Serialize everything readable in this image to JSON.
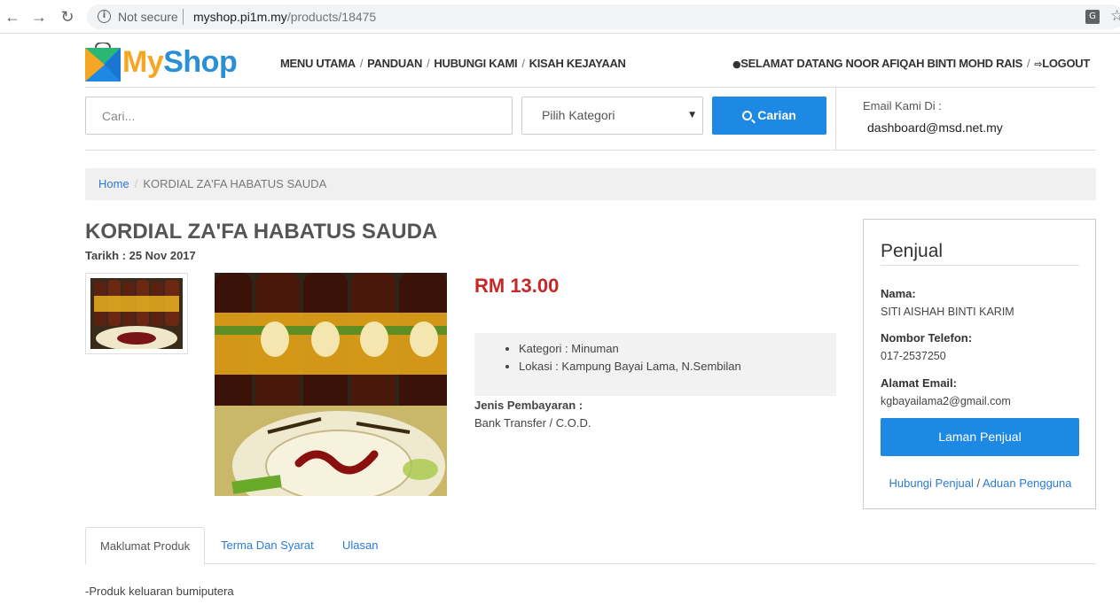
{
  "browser": {
    "security_label": "Not secure",
    "url_host": "myshop.pi1m.my",
    "url_path": "/products/18475"
  },
  "header": {
    "logo_my": "My",
    "logo_shop": "Shop",
    "nav": [
      "MENU UTAMA",
      "PANDUAN",
      "HUBUNGI KAMI",
      "KISAH KEJAYAAN"
    ],
    "welcome": "SELAMAT DATANG NOOR AFIQAH BINTI MOHD RAIS",
    "logout": "LOGOUT"
  },
  "search": {
    "placeholder": "Cari...",
    "category_selected": "Pilih Kategori",
    "button_label": "Carian",
    "email_label": "Email Kami Di :",
    "email_value": "dashboard@msd.net.my"
  },
  "breadcrumb": {
    "home": "Home",
    "current": "KORDIAL ZA'FA HABATUS SAUDA"
  },
  "product": {
    "title": "KORDIAL ZA'FA HABATUS SAUDA",
    "date": "Tarikh : 25 Nov 2017",
    "price": "RM 13.00",
    "kategori": "Kategori : Minuman",
    "lokasi": "Lokasi : Kampung Bayai Lama, N.Sembilan",
    "payment_label": "Jenis Pembayaran :",
    "payment_value": "Bank Transfer / C.O.D."
  },
  "seller": {
    "title": "Penjual",
    "name_label": "Nama:",
    "name_value": "SITI AISHAH BINTI KARIM",
    "phone_label": "Nombor Telefon:",
    "phone_value": "017-2537250",
    "email_label": "Alamat Email:",
    "email_value": "kgbayailama2@gmail.com",
    "button_label": "Laman Penjual",
    "contact_link": "Hubungi Penjual",
    "link_sep": " / ",
    "report_link": "Aduan Pengguna"
  },
  "tabs": [
    {
      "label": "Maklumat Produk",
      "active": true
    },
    {
      "label": "Terma Dan Syarat",
      "active": false
    },
    {
      "label": "Ulasan",
      "active": false
    }
  ],
  "tab_content": "-Produk keluaran bumiputera",
  "icons": {
    "back": "back-arrow-icon",
    "forward": "forward-arrow-icon",
    "reload": "reload-icon",
    "info": "info-icon",
    "translate": "translate-icon",
    "bookmark": "star-icon",
    "user": "user-icon",
    "logout": "logout-icon",
    "search": "search-icon",
    "caret": "caret-down-icon"
  },
  "colors": {
    "accent": "#1e88e5",
    "price": "#c62828",
    "link": "#2a7ad6"
  }
}
